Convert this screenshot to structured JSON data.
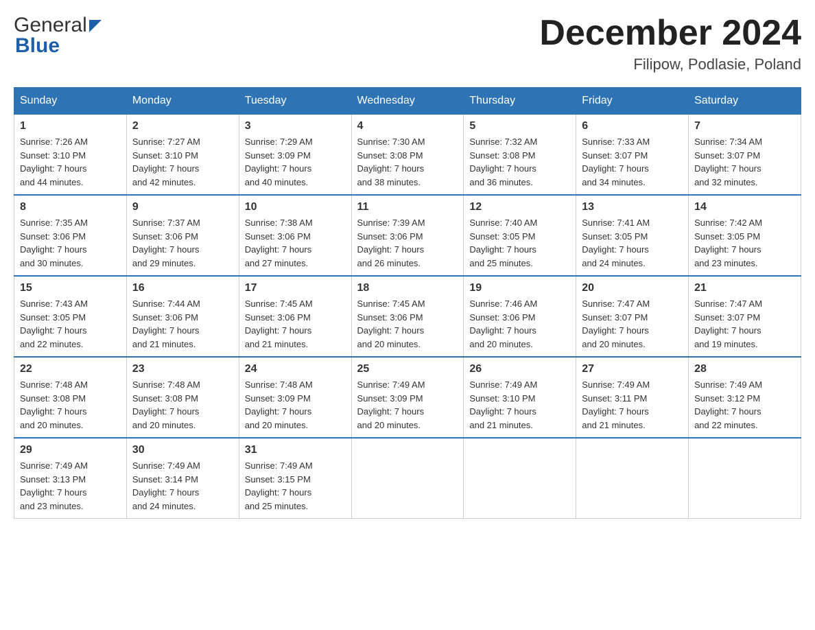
{
  "header": {
    "logo_general": "General",
    "logo_blue": "Blue",
    "month_title": "December 2024",
    "location": "Filipow, Podlasie, Poland"
  },
  "days_of_week": [
    "Sunday",
    "Monday",
    "Tuesday",
    "Wednesday",
    "Thursday",
    "Friday",
    "Saturday"
  ],
  "weeks": [
    [
      {
        "day": "1",
        "sunrise": "7:26 AM",
        "sunset": "3:10 PM",
        "daylight": "7 hours and 44 minutes."
      },
      {
        "day": "2",
        "sunrise": "7:27 AM",
        "sunset": "3:10 PM",
        "daylight": "7 hours and 42 minutes."
      },
      {
        "day": "3",
        "sunrise": "7:29 AM",
        "sunset": "3:09 PM",
        "daylight": "7 hours and 40 minutes."
      },
      {
        "day": "4",
        "sunrise": "7:30 AM",
        "sunset": "3:08 PM",
        "daylight": "7 hours and 38 minutes."
      },
      {
        "day": "5",
        "sunrise": "7:32 AM",
        "sunset": "3:08 PM",
        "daylight": "7 hours and 36 minutes."
      },
      {
        "day": "6",
        "sunrise": "7:33 AM",
        "sunset": "3:07 PM",
        "daylight": "7 hours and 34 minutes."
      },
      {
        "day": "7",
        "sunrise": "7:34 AM",
        "sunset": "3:07 PM",
        "daylight": "7 hours and 32 minutes."
      }
    ],
    [
      {
        "day": "8",
        "sunrise": "7:35 AM",
        "sunset": "3:06 PM",
        "daylight": "7 hours and 30 minutes."
      },
      {
        "day": "9",
        "sunrise": "7:37 AM",
        "sunset": "3:06 PM",
        "daylight": "7 hours and 29 minutes."
      },
      {
        "day": "10",
        "sunrise": "7:38 AM",
        "sunset": "3:06 PM",
        "daylight": "7 hours and 27 minutes."
      },
      {
        "day": "11",
        "sunrise": "7:39 AM",
        "sunset": "3:06 PM",
        "daylight": "7 hours and 26 minutes."
      },
      {
        "day": "12",
        "sunrise": "7:40 AM",
        "sunset": "3:05 PM",
        "daylight": "7 hours and 25 minutes."
      },
      {
        "day": "13",
        "sunrise": "7:41 AM",
        "sunset": "3:05 PM",
        "daylight": "7 hours and 24 minutes."
      },
      {
        "day": "14",
        "sunrise": "7:42 AM",
        "sunset": "3:05 PM",
        "daylight": "7 hours and 23 minutes."
      }
    ],
    [
      {
        "day": "15",
        "sunrise": "7:43 AM",
        "sunset": "3:05 PM",
        "daylight": "7 hours and 22 minutes."
      },
      {
        "day": "16",
        "sunrise": "7:44 AM",
        "sunset": "3:06 PM",
        "daylight": "7 hours and 21 minutes."
      },
      {
        "day": "17",
        "sunrise": "7:45 AM",
        "sunset": "3:06 PM",
        "daylight": "7 hours and 21 minutes."
      },
      {
        "day": "18",
        "sunrise": "7:45 AM",
        "sunset": "3:06 PM",
        "daylight": "7 hours and 20 minutes."
      },
      {
        "day": "19",
        "sunrise": "7:46 AM",
        "sunset": "3:06 PM",
        "daylight": "7 hours and 20 minutes."
      },
      {
        "day": "20",
        "sunrise": "7:47 AM",
        "sunset": "3:07 PM",
        "daylight": "7 hours and 20 minutes."
      },
      {
        "day": "21",
        "sunrise": "7:47 AM",
        "sunset": "3:07 PM",
        "daylight": "7 hours and 19 minutes."
      }
    ],
    [
      {
        "day": "22",
        "sunrise": "7:48 AM",
        "sunset": "3:08 PM",
        "daylight": "7 hours and 20 minutes."
      },
      {
        "day": "23",
        "sunrise": "7:48 AM",
        "sunset": "3:08 PM",
        "daylight": "7 hours and 20 minutes."
      },
      {
        "day": "24",
        "sunrise": "7:48 AM",
        "sunset": "3:09 PM",
        "daylight": "7 hours and 20 minutes."
      },
      {
        "day": "25",
        "sunrise": "7:49 AM",
        "sunset": "3:09 PM",
        "daylight": "7 hours and 20 minutes."
      },
      {
        "day": "26",
        "sunrise": "7:49 AM",
        "sunset": "3:10 PM",
        "daylight": "7 hours and 21 minutes."
      },
      {
        "day": "27",
        "sunrise": "7:49 AM",
        "sunset": "3:11 PM",
        "daylight": "7 hours and 21 minutes."
      },
      {
        "day": "28",
        "sunrise": "7:49 AM",
        "sunset": "3:12 PM",
        "daylight": "7 hours and 22 minutes."
      }
    ],
    [
      {
        "day": "29",
        "sunrise": "7:49 AM",
        "sunset": "3:13 PM",
        "daylight": "7 hours and 23 minutes."
      },
      {
        "day": "30",
        "sunrise": "7:49 AM",
        "sunset": "3:14 PM",
        "daylight": "7 hours and 24 minutes."
      },
      {
        "day": "31",
        "sunrise": "7:49 AM",
        "sunset": "3:15 PM",
        "daylight": "7 hours and 25 minutes."
      },
      null,
      null,
      null,
      null
    ]
  ],
  "labels": {
    "sunrise": "Sunrise:",
    "sunset": "Sunset:",
    "daylight": "Daylight:"
  }
}
